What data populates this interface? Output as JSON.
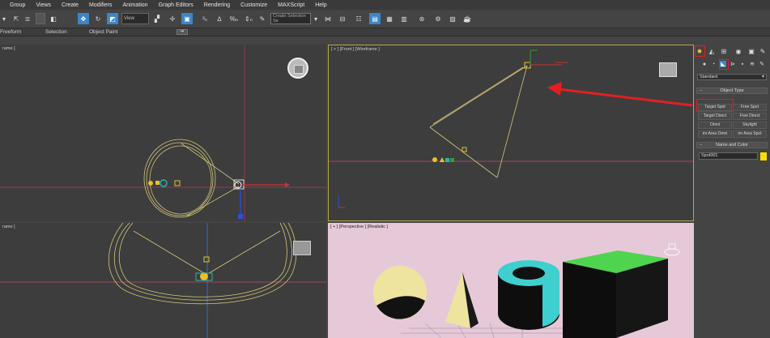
{
  "menu": [
    "Group",
    "Views",
    "Create",
    "Modifiers",
    "Animation",
    "Graph Editors",
    "Rendering",
    "Customize",
    "MAXScript",
    "Help"
  ],
  "toolbar": {
    "view_dropdown": "View",
    "selection_set_dropdown": "Create Selection Se"
  },
  "ribbon": {
    "tabs": [
      "Freeform",
      "Selection",
      "Object Paint"
    ]
  },
  "viewports": {
    "top_left_label": "rame ]",
    "front_label": "[ + ] [Front ] [Wireframe ]",
    "bottom_left_label": "rame ]",
    "perspective_label": "[ + ] [Perspective ] [Realistic ]"
  },
  "command_panel": {
    "category_dropdown": "Standard",
    "object_type_title": "Object Type",
    "buttons": [
      [
        "Target Spot",
        "Free Spot"
      ],
      [
        "Target Direct",
        "Free Direct"
      ],
      [
        "Omni",
        "Skylight"
      ],
      [
        "mr Area Omni",
        "mr Area Spot"
      ]
    ],
    "name_color_title": "Name and Color",
    "object_name": "Spot001",
    "object_color": "#f5e000",
    "selected_button": "Target Spot"
  },
  "colors": {
    "highlight": "#e02020",
    "front_viewport_border": "#b9a64a",
    "perspective_background": "#e6c9d9",
    "cube_top": "#4fd44f",
    "torus": "#3fcfcf",
    "sphere": "#efe3a0"
  }
}
